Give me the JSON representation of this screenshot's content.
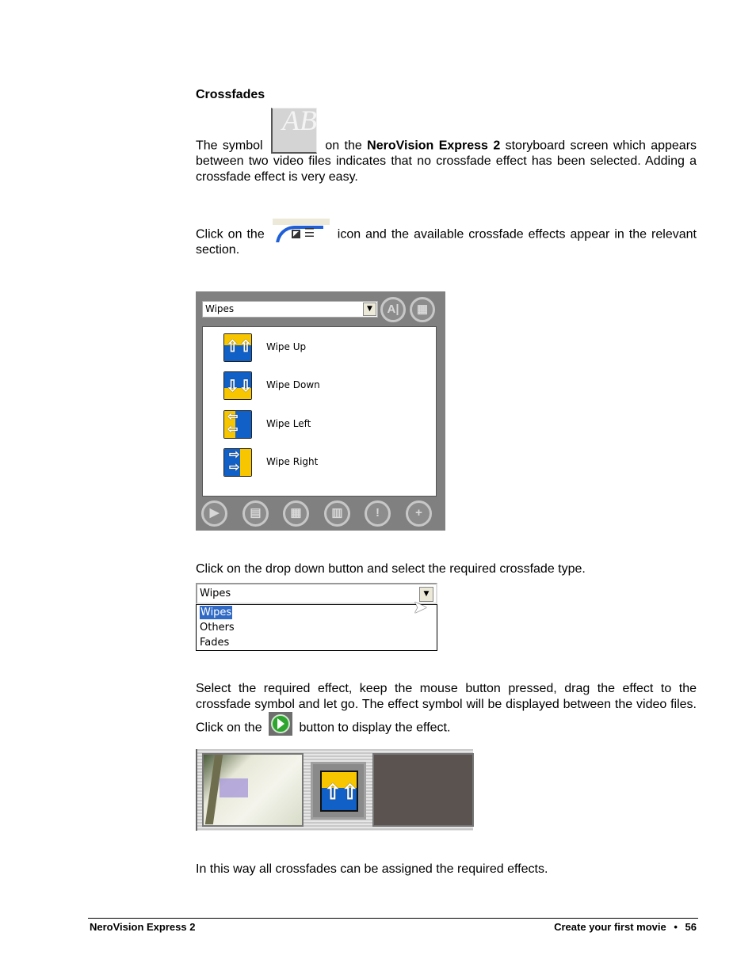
{
  "section_title": "Crossfades",
  "para1": {
    "pre": "The symbol",
    "mid": "on the",
    "bold": "NeroVision Express 2",
    "post": "storyboard screen which appears between two video files indicates that no crossfade effect has been selected. Adding a crossfade effect is very easy.",
    "icon": "no-crossfade-ab-icon"
  },
  "para2": {
    "pre": "Click on the",
    "post": "icon and the available crossfade effects appear in the relevant section.",
    "icon": "crossfade-tab-icon"
  },
  "panel": {
    "dropdown_value": "Wipes",
    "top_buttons": [
      {
        "icon": "text-effect-icon",
        "glyph": "A|"
      },
      {
        "icon": "apply-grid-icon",
        "glyph": "▦"
      }
    ],
    "effects": [
      {
        "label": "Wipe Up",
        "icon": "wipe-up-icon"
      },
      {
        "label": "Wipe Down",
        "icon": "wipe-down-icon"
      },
      {
        "label": "Wipe Left",
        "icon": "wipe-left-icon"
      },
      {
        "label": "Wipe Right",
        "icon": "wipe-right-icon"
      }
    ],
    "bottom_buttons": [
      {
        "icon": "preview-zoom-icon",
        "glyph": "▶"
      },
      {
        "icon": "film-icon",
        "glyph": "▤"
      },
      {
        "icon": "grid-down-icon",
        "glyph": "▦"
      },
      {
        "icon": "grid-apply-icon",
        "glyph": "▥"
      },
      {
        "icon": "exclamation-icon",
        "glyph": "!"
      },
      {
        "icon": "plus-icon",
        "glyph": "+"
      }
    ]
  },
  "para3": "Click on the drop down button and select the required crossfade type.",
  "dropdown_demo": {
    "value": "Wipes",
    "options": [
      "Wipes",
      "Others",
      "Fades"
    ],
    "selected": "Wipes"
  },
  "para4": {
    "pre": "Select the required effect, keep the mouse button pressed, drag the effect to the crossfade symbol and let go. The effect symbol will be displayed between the video files. Click on the",
    "post": "button to display the effect.",
    "icon": "play-icon"
  },
  "para5": "In this way all crossfades can be assigned the required effects.",
  "footer": {
    "left": "NeroVision Express 2",
    "right_text": "Create your first movie",
    "bullet": "•",
    "page": "56"
  },
  "colors": {
    "panel_bg": "#808080",
    "wipe_yellow": "#f7c600",
    "wipe_blue": "#1060c8",
    "selection": "#316ac5",
    "play_green": "#2ea52e"
  }
}
